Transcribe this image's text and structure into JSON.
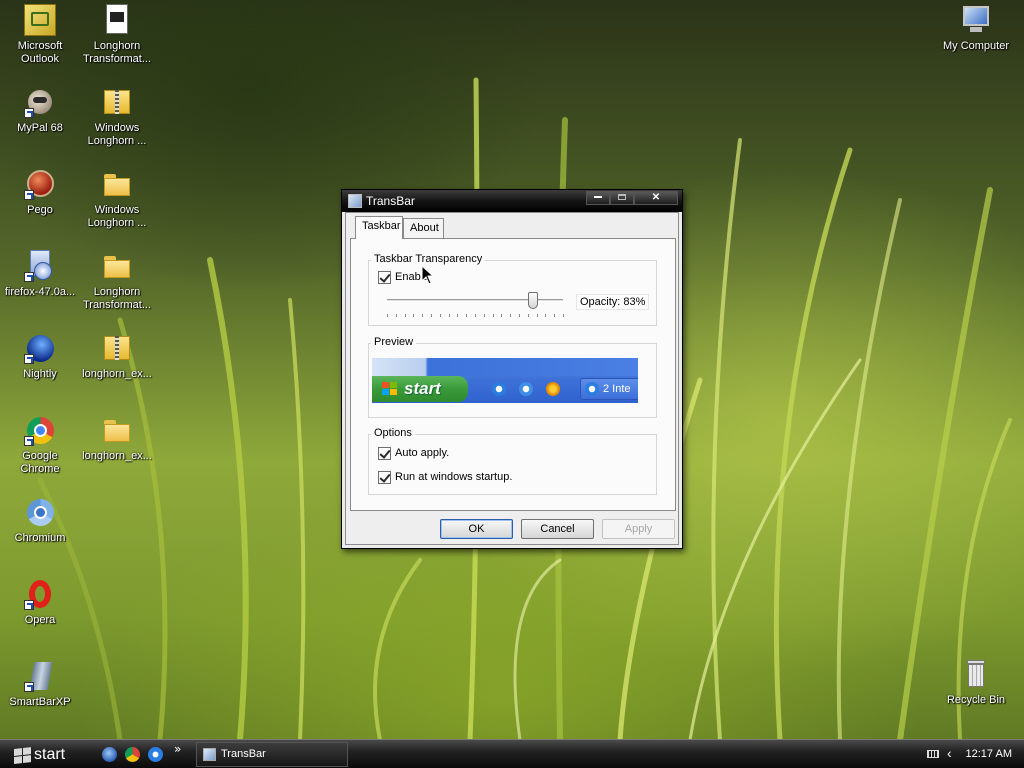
{
  "desktop": {
    "icons_left": [
      {
        "label": "Microsoft Outlook",
        "line1": "Microsoft",
        "line2": "Outlook",
        "icon": "outlook-icon"
      },
      {
        "label": "Longhorn Transformat...",
        "line1": "Longhorn",
        "line2": "Transformat...",
        "icon": "document-icon"
      },
      {
        "label": "MyPal 68",
        "line1": "MyPal 68",
        "line2": "",
        "icon": "mypal-icon"
      },
      {
        "label": "Windows Longhorn ...",
        "line1": "Windows",
        "line2": "Longhorn ...",
        "icon": "zip-folder-icon"
      },
      {
        "label": "Pego",
        "line1": "Pego",
        "line2": "",
        "icon": "pego-icon"
      },
      {
        "label": "Windows Longhorn ...",
        "line1": "Windows",
        "line2": "Longhorn ...",
        "icon": "folder-icon"
      },
      {
        "label": "firefox-47.0a...",
        "line1": "firefox-47.0a...",
        "line2": "",
        "icon": "installer-icon"
      },
      {
        "label": "Longhorn Transformat...",
        "line1": "Longhorn",
        "line2": "Transformat...",
        "icon": "folder-icon"
      },
      {
        "label": "Nightly",
        "line1": "Nightly",
        "line2": "",
        "icon": "nightly-icon"
      },
      {
        "label": "longhorn_ex...",
        "line1": "longhorn_ex...",
        "line2": "",
        "icon": "zip-folder-icon"
      },
      {
        "label": "Google Chrome",
        "line1": "Google",
        "line2": "Chrome",
        "icon": "chrome-icon"
      },
      {
        "label": "longhorn_ex...",
        "line1": "longhorn_ex...",
        "line2": "",
        "icon": "folder-icon"
      },
      {
        "label": "Chromium",
        "line1": "Chromium",
        "line2": "",
        "icon": "chromium-icon"
      },
      {
        "label": "Opera",
        "line1": "Opera",
        "line2": "",
        "icon": "opera-icon"
      },
      {
        "label": "SmartBarXP",
        "line1": "SmartBarXP",
        "line2": "",
        "icon": "smartbar-icon"
      }
    ],
    "my_computer": "My Computer",
    "recycle_bin": "Recycle Bin"
  },
  "window": {
    "title": "TransBar",
    "tabs": [
      "Taskbar",
      "About"
    ],
    "transparency": {
      "group_title": "Taskbar Transparency",
      "enable_label": "Enable",
      "enable_checked": true,
      "opacity_label": "Opacity: 83%",
      "opacity_value": 0.83
    },
    "preview": {
      "group_title": "Preview",
      "start_label": "start",
      "task_label": "2 Inte"
    },
    "options": {
      "group_title": "Options",
      "auto_apply": "Auto apply.",
      "run_startup": "Run at windows startup."
    },
    "buttons": {
      "ok": "OK",
      "cancel": "Cancel",
      "apply": "Apply"
    }
  },
  "taskbar": {
    "start_label": "start",
    "more_label": "»",
    "task_label": "TransBar",
    "clock": "12:17 AM",
    "tray_arrow": "‹"
  }
}
